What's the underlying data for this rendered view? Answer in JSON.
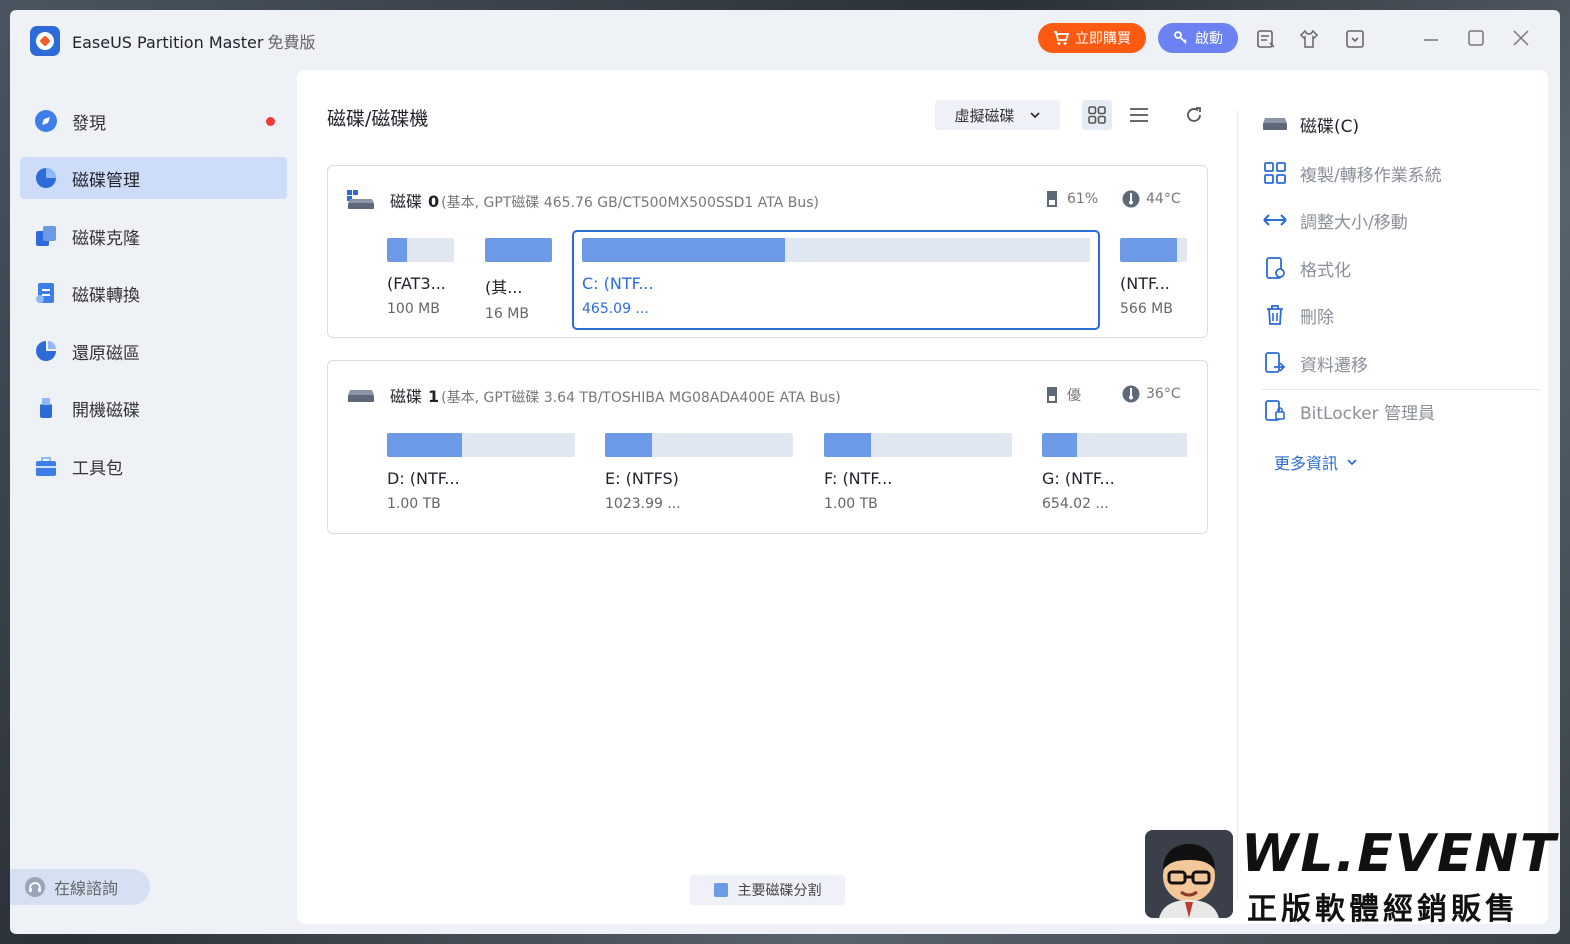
{
  "app": {
    "title": "EaseUS Partition Master",
    "edition": "免費版",
    "buy_label": "立即購買",
    "activate_label": "啟動"
  },
  "sidebar": {
    "items": [
      {
        "label": "發現",
        "icon": "compass-icon"
      },
      {
        "label": "磁碟管理",
        "icon": "pie-chart-icon"
      },
      {
        "label": "磁碟克隆",
        "icon": "clone-icon"
      },
      {
        "label": "磁碟轉換",
        "icon": "convert-icon"
      },
      {
        "label": "還原磁區",
        "icon": "recover-icon"
      },
      {
        "label": "開機磁碟",
        "icon": "usb-icon"
      },
      {
        "label": "工具包",
        "icon": "toolbox-icon"
      }
    ],
    "online_label": "在線諮詢"
  },
  "main": {
    "title": "磁碟/磁碟機",
    "virtual_disk_label": "虛擬磁碟",
    "legend_label": "主要磁碟分割"
  },
  "disks": [
    {
      "name": "磁碟",
      "number": "0",
      "detail": "(基本, GPT磁碟 465.76 GB/CT500MX500SSD1 ATA Bus)",
      "health": "61%",
      "temp": "44°C",
      "partitions": [
        {
          "name": "(FAT3...",
          "size": "100 MB",
          "fill": 0.3
        },
        {
          "name": "(其...",
          "size": "16 MB",
          "fill": 1.0
        },
        {
          "name": "C: (NTF...",
          "size": "465.09 ...",
          "fill": 0.4
        },
        {
          "name": "(NTF...",
          "size": "566 MB",
          "fill": 0.85
        }
      ]
    },
    {
      "name": "磁碟",
      "number": "1",
      "detail": "(基本, GPT磁碟 3.64 TB/TOSHIBA MG08ADA400E ATA Bus)",
      "health": "優",
      "temp": "36°C",
      "partitions": [
        {
          "name": "D: (NTF...",
          "size": "1.00 TB",
          "fill": 0.4
        },
        {
          "name": "E: (NTFS)",
          "size": "1023.99 ...",
          "fill": 0.25
        },
        {
          "name": "F: (NTF...",
          "size": "1.00 TB",
          "fill": 0.25
        },
        {
          "name": "G: (NTF...",
          "size": "654.02 ...",
          "fill": 0.24
        }
      ]
    }
  ],
  "actions": {
    "current": "磁碟(C)",
    "items": [
      "複製/轉移作業系統",
      "調整大小/移動",
      "格式化",
      "刪除",
      "資料遷移"
    ],
    "bitlocker": "BitLocker 管理員",
    "more": "更多資訊"
  },
  "watermark": {
    "title": "WL.EVENT",
    "subtitle": "正版軟體經銷販售"
  },
  "colors": {
    "accent": "#2d6bd9",
    "partition_fill": "#6d9ae6",
    "buy": "#ff5a12",
    "activate": "#6c82f2"
  }
}
